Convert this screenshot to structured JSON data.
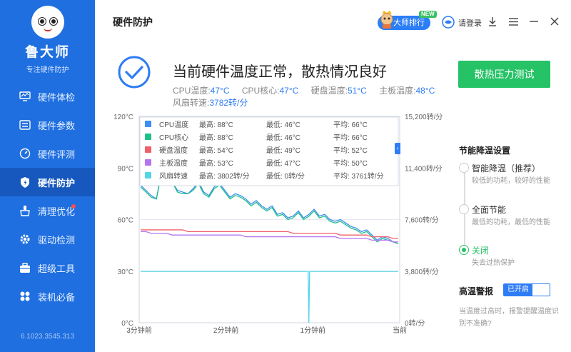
{
  "app": {
    "name": "鲁大师",
    "slogan": "专注硬件防护",
    "version": "6.1023.3545.313"
  },
  "sidebar": {
    "items": [
      {
        "label": "硬件体检",
        "icon": "monitor-icon",
        "active": false
      },
      {
        "label": "硬件参数",
        "icon": "sliders-icon",
        "active": false
      },
      {
        "label": "硬件评测",
        "icon": "gauge-icon",
        "active": false
      },
      {
        "label": "硬件防护",
        "icon": "shield-icon",
        "active": true
      },
      {
        "label": "清理优化",
        "icon": "broom-icon",
        "active": false,
        "badge": "red-dot"
      },
      {
        "label": "驱动检测",
        "icon": "gear-icon",
        "active": false
      },
      {
        "label": "超级工具",
        "icon": "toolbox-icon",
        "active": false
      },
      {
        "label": "装机必备",
        "icon": "apps-icon",
        "active": false
      }
    ]
  },
  "titlebar": {
    "title": "硬件防护",
    "rank_label": "大师排行",
    "new_badge": "NEW",
    "login_label": "请登录"
  },
  "status": {
    "title": "当前硬件温度正常，散热情况良好",
    "readings": [
      {
        "label": "CPU温度:",
        "value": "47°C"
      },
      {
        "label": "CPU核心:",
        "value": "47°C"
      },
      {
        "label": "硬盘温度:",
        "value": "51°C"
      },
      {
        "label": "主板温度:",
        "value": "48°C"
      }
    ],
    "fan_label": "风扇转速:",
    "fan_value": "3782转/分",
    "stress_button": "散热压力测试"
  },
  "chart_data": {
    "type": "line",
    "x_labels": [
      "3分钟前",
      "2分钟前",
      "1分钟前",
      "当前"
    ],
    "y_left_ticks": [
      "0°C",
      "30°C",
      "60°C",
      "90°C",
      "120°C"
    ],
    "y_right_ticks": [
      "0转/分",
      "3,800转/分",
      "7,600转/分",
      "11,400转/分",
      "15,200转/分"
    ],
    "ylim": [
      0,
      120
    ],
    "legend": [
      {
        "name": "CPU温度",
        "color": "#3d8ef0",
        "max": "最高: 88°C",
        "min": "最低: 46°C",
        "avg": "平均: 66°C"
      },
      {
        "name": "CPU核心",
        "color": "#1dbf8a",
        "max": "最高: 88°C",
        "min": "最低: 46°C",
        "avg": "平均: 66°C"
      },
      {
        "name": "硬盘温度",
        "color": "#f0606a",
        "max": "最高: 54°C",
        "min": "最低: 49°C",
        "avg": "平均: 52°C"
      },
      {
        "name": "主板温度",
        "color": "#b574f0",
        "max": "最高: 53°C",
        "min": "最低: 47°C",
        "avg": "平均: 50°C"
      },
      {
        "name": "风扇转速",
        "color": "#55d4e6",
        "max": "最高: 3802转/分",
        "min": "最低: 0转/分",
        "avg": "平均: 3761转/分"
      }
    ],
    "series": [
      {
        "name": "CPU温度",
        "color": "#3d8ef0",
        "values": [
          80,
          77,
          74,
          72,
          88,
          84,
          82,
          77,
          76,
          75,
          78,
          82,
          76,
          74,
          79,
          81,
          77,
          73,
          75,
          74,
          72,
          69,
          71,
          68,
          66,
          68,
          63,
          64,
          61,
          62,
          65,
          61,
          63,
          66,
          62,
          63,
          60,
          59,
          60,
          58,
          56,
          55,
          53,
          54,
          51,
          48,
          50,
          49,
          47,
          46
        ]
      },
      {
        "name": "CPU核心",
        "color": "#1dbf8a",
        "values": [
          79,
          76,
          73,
          72,
          87,
          83,
          82,
          76,
          75,
          75,
          77,
          81,
          75,
          73,
          78,
          80,
          76,
          72,
          74,
          73,
          71,
          68,
          70,
          67,
          65,
          67,
          62,
          63,
          60,
          61,
          64,
          60,
          62,
          65,
          61,
          62,
          59,
          58,
          59,
          57,
          55,
          54,
          52,
          53,
          50,
          47,
          49,
          48,
          47,
          46
        ]
      },
      {
        "name": "硬盘温度",
        "color": "#f0606a",
        "values": [
          54,
          54,
          54,
          54,
          54,
          54,
          54,
          54,
          54,
          53,
          53,
          53,
          53,
          53,
          53,
          53,
          53,
          53,
          53,
          53,
          53,
          53,
          53,
          53,
          53,
          53,
          53,
          53,
          53,
          52,
          52,
          52,
          52,
          52,
          52,
          52,
          52,
          52,
          51,
          51,
          51,
          51,
          51,
          51,
          50,
          50,
          50,
          50,
          49,
          49
        ]
      },
      {
        "name": "主板温度",
        "color": "#b574f0",
        "values": [
          53,
          53,
          52,
          52,
          52,
          52,
          51,
          51,
          51,
          51,
          51,
          51,
          51,
          51,
          51,
          51,
          51,
          51,
          51,
          51,
          50,
          50,
          50,
          50,
          50,
          50,
          50,
          50,
          50,
          50,
          50,
          50,
          50,
          50,
          50,
          50,
          50,
          50,
          49,
          49,
          49,
          49,
          49,
          49,
          48,
          48,
          48,
          48,
          47,
          47
        ]
      },
      {
        "name": "风扇转速",
        "color": "#55d4e6",
        "values": [
          3780,
          3780,
          3780,
          3780,
          3780,
          3780,
          3780,
          3780,
          3780,
          3780,
          3780,
          3780,
          3780,
          3780,
          3780,
          3780,
          3780,
          3780,
          3780,
          3780,
          3780,
          3780,
          3780,
          3780,
          3780,
          3780,
          3780,
          3780,
          3780,
          3780,
          3780,
          3780,
          3780,
          3780,
          3780,
          3780,
          3780,
          3780,
          3780,
          3780,
          3780,
          3780,
          3780,
          3780,
          3780,
          3780,
          3780,
          3780,
          3780,
          3782
        ],
        "dip_at_index": 32,
        "dip_value": 0,
        "ylim": [
          0,
          15200
        ]
      }
    ]
  },
  "settings": {
    "title": "节能降温设置",
    "options": [
      {
        "label": "智能降温（推荐）",
        "desc": "较低的功耗，较好的性能",
        "selected": false
      },
      {
        "label": "全面节能",
        "desc": "最低的功耗，最低的性能",
        "selected": false
      },
      {
        "label": "关闭",
        "desc": "失去过热保护",
        "selected": true
      }
    ],
    "alarm_label": "高温警报",
    "alarm_state": "已开启",
    "alarm_desc": "当温度过高时，报警提醒温度识别不准确?"
  }
}
